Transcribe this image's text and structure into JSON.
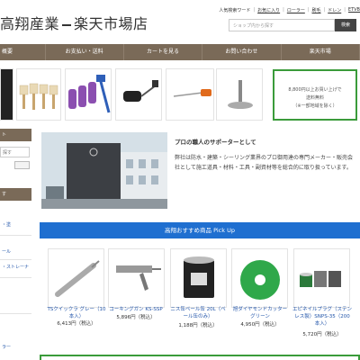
{
  "header": {
    "store_name": "高翔産業",
    "store_suffix": "楽天市場店",
    "links": [
      "人気検索ワード",
      "お気に入り",
      "ローラー",
      "刷毛",
      "ドレン",
      "ETVB"
    ],
    "search_placeholder": "ショップ内から探す",
    "search_button": "検索"
  },
  "nav": {
    "items": [
      "概要",
      "お支払い・送料",
      "カートを見る",
      "お問い合わせ",
      "楽天市場"
    ]
  },
  "free_shipping": {
    "line1": "8,800円以上お買い上げで",
    "line2": "送料無料",
    "line3": "（※一部地域を除く）"
  },
  "sidebar": {
    "head1": "ト",
    "search_value": "探す",
    "head2": "す",
    "link1": "・塗",
    "link2": "ール",
    "link3": "・ストレーナ",
    "link4": "ラー"
  },
  "about": {
    "title": "プロの職人のサポーターとして",
    "body": "弊社は防水・建築・シーリング業界のプロ御用達の専門メーカー・販売会社として施工道具・材料・工具・副資材等を総合的に取り扱っています。"
  },
  "pickup": {
    "title": "高翔おすすめ商品 Pick Up",
    "products": [
      {
        "name": "TSクイックラ グレー（10本入）",
        "price": "6,413円（税込）"
      },
      {
        "name": "コーキングガン KS-SSP",
        "price": "5,896円（税込）"
      },
      {
        "name": "ニス缶ペール缶 20L（ペール缶のみ）",
        "price": "1,188円（税込）"
      },
      {
        "name": "旭ダイヤモンドカッター グリーン",
        "price": "4,950円（税込）"
      },
      {
        "name": "エピネイルプラグ（ステンレス製）SNPS-35（200本入）",
        "price": "5,720円（税込）"
      }
    ]
  },
  "colors": {
    "nav_bg": "#7a6a58",
    "pickup_bg": "#1f6fd0",
    "shipping_border": "#3a9b3a",
    "link": "#2255aa"
  }
}
